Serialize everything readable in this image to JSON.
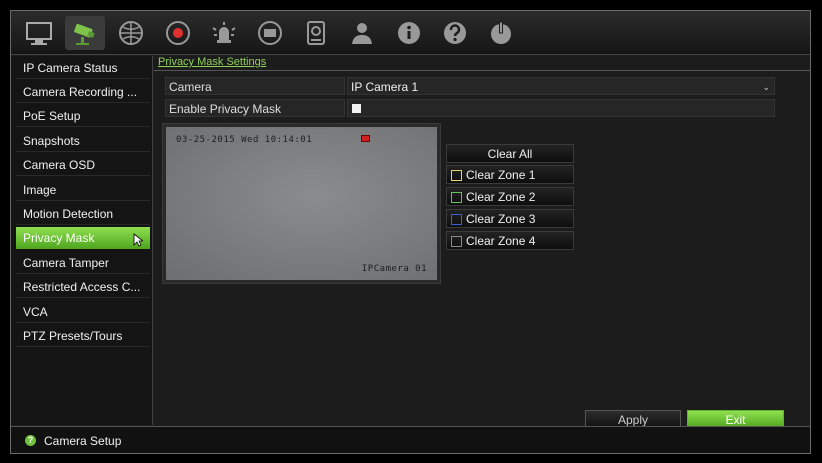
{
  "toolbar": {
    "items": [
      {
        "icon": "monitor-icon"
      },
      {
        "icon": "camera-setup-icon",
        "active": true
      },
      {
        "icon": "network-icon"
      },
      {
        "icon": "record-icon"
      },
      {
        "icon": "alarm-icon"
      },
      {
        "icon": "device-icon"
      },
      {
        "icon": "storage-icon"
      },
      {
        "icon": "user-icon"
      },
      {
        "icon": "info-icon"
      },
      {
        "icon": "help-icon"
      },
      {
        "icon": "power-icon"
      }
    ]
  },
  "sidebar": {
    "items": [
      {
        "label": "IP Camera Status"
      },
      {
        "label": "Camera Recording ..."
      },
      {
        "label": "PoE Setup"
      },
      {
        "label": "Snapshots"
      },
      {
        "label": "Camera OSD"
      },
      {
        "label": "Image"
      },
      {
        "label": "Motion Detection"
      },
      {
        "label": "Privacy Mask",
        "selected": true
      },
      {
        "label": "Camera Tamper"
      },
      {
        "label": "Restricted Access C..."
      },
      {
        "label": "VCA"
      },
      {
        "label": "PTZ Presets/Tours"
      }
    ]
  },
  "main": {
    "tab_label": "Privacy Mask Settings",
    "camera_label": "Camera",
    "camera_value": "IP Camera 1",
    "enable_label": "Enable Privacy Mask",
    "enable_checked": false,
    "preview": {
      "osd_datetime": "03-25-2015 Wed 10:14:01",
      "osd_camera_name": "IPCamera 01"
    },
    "zones": {
      "clear_all": "Clear All",
      "items": [
        {
          "label": "Clear Zone 1",
          "color": "#e6d66a"
        },
        {
          "label": "Clear Zone 2",
          "color": "#5ec45e"
        },
        {
          "label": "Clear Zone 3",
          "color": "#3a5fd8"
        },
        {
          "label": "Clear Zone 4",
          "color": "#8a8a8a"
        }
      ]
    },
    "apply_label": "Apply",
    "exit_label": "Exit"
  },
  "status": {
    "icon": "help-icon",
    "text": "Camera Setup"
  },
  "colors": {
    "accent": "#6fbf3a"
  }
}
